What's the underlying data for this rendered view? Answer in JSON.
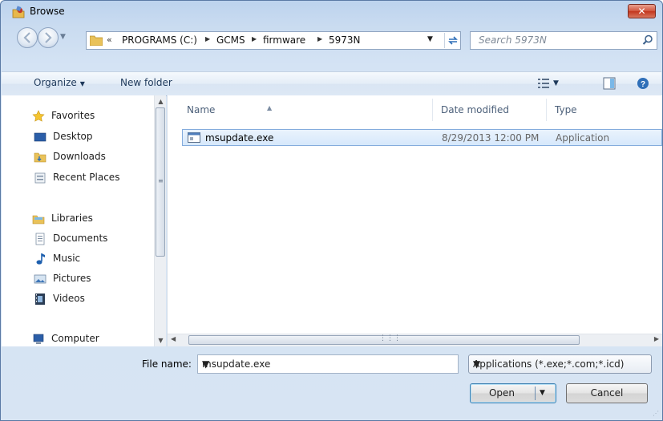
{
  "window": {
    "title": "Browse",
    "close_label": "✕"
  },
  "address": {
    "overflow": "«",
    "crumbs": [
      "PROGRAMS (C:)",
      "GCMS",
      "firmware",
      "5973N"
    ],
    "search_placeholder": "Search 5973N"
  },
  "toolbar": {
    "organize": "Organize",
    "new_folder": "New folder"
  },
  "nav_pane": {
    "items": [
      {
        "label": "Favorites",
        "icon": "star-icon"
      },
      {
        "label": "Desktop",
        "icon": "desktop-icon"
      },
      {
        "label": "Downloads",
        "icon": "downloads-icon"
      },
      {
        "label": "Recent Places",
        "icon": "recent-places-icon"
      },
      {
        "label": "Libraries",
        "icon": "libraries-icon"
      },
      {
        "label": "Documents",
        "icon": "documents-icon"
      },
      {
        "label": "Music",
        "icon": "music-icon"
      },
      {
        "label": "Pictures",
        "icon": "pictures-icon"
      },
      {
        "label": "Videos",
        "icon": "videos-icon"
      },
      {
        "label": "Computer",
        "icon": "computer-icon"
      }
    ]
  },
  "files": {
    "columns": {
      "name": "Name",
      "date": "Date modified",
      "type": "Type"
    },
    "rows": [
      {
        "name": "msupdate.exe",
        "date": "8/29/2013 12:00 PM",
        "type": "Application"
      }
    ]
  },
  "bottom": {
    "file_name_label": "File name:",
    "file_name_value": "msupdate.exe",
    "file_type_value": "Applications (*.exe;*.com;*.icd)",
    "open_label": "Open",
    "cancel_label": "Cancel"
  },
  "colors": {
    "selection": "#d6e8fb",
    "frame": "#d7e4f3",
    "accent_close": "#c2351d"
  }
}
